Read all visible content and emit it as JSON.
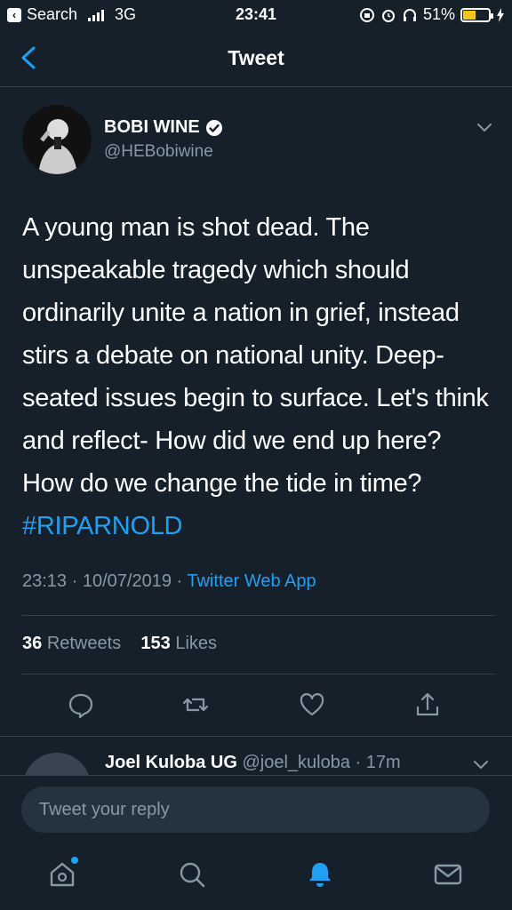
{
  "status_bar": {
    "back_app_label": "Search",
    "carrier": "3G",
    "time": "23:41",
    "battery": "51%",
    "battery_level": 0.51
  },
  "header": {
    "title": "Tweet"
  },
  "tweet": {
    "author_name": "BOBI WINE",
    "handle": "@HEBobiwine",
    "text": "A young man is shot dead. The unspeakable tragedy which should ordinarily unite a nation in grief, instead stirs a debate on national unity. Deep-seated issues begin to surface. Let's think and reflect- How did we end up here? How do we change the tide in time?",
    "hashtag": "#RIPARNOLD",
    "time": "23:13",
    "date": "10/07/2019",
    "source": "Twitter Web App",
    "retweets_count": "36",
    "retweets_label": "Retweets",
    "likes_count": "153",
    "likes_label": "Likes"
  },
  "reply_preview": {
    "name": "Joel Kuloba UG",
    "handle": "@joel_kuloba",
    "age": "· 17m"
  },
  "reply_box": {
    "placeholder": "Tweet your reply"
  },
  "colors": {
    "background": "#15202b",
    "accent": "#1da1f2",
    "muted": "#8899a6",
    "divider": "#38444d"
  }
}
